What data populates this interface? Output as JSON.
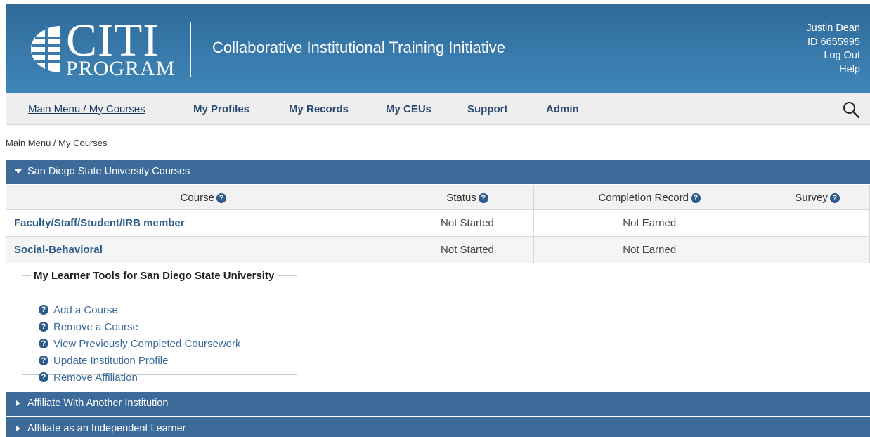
{
  "header": {
    "logo_top": "CITI",
    "logo_bottom": "PROGRAM",
    "tagline": "Collaborative Institutional Training Initiative",
    "user_name": "Justin Dean",
    "user_id": "ID 6655995",
    "logout": "Log Out",
    "help": "Help",
    "brand_color": "#3a7bb0"
  },
  "nav": {
    "items": [
      {
        "label": "Main Menu / My Courses"
      },
      {
        "label": "My Profiles"
      },
      {
        "label": "My Records"
      },
      {
        "label": "My CEUs"
      },
      {
        "label": "Support"
      },
      {
        "label": "Admin"
      }
    ],
    "search_icon": "search-icon"
  },
  "breadcrumb": "Main Menu / My Courses",
  "sections": {
    "sdsu": "San Diego State University Courses",
    "affiliate_other": "Affiliate With Another Institution",
    "affiliate_independent": "Affiliate as an Independent Learner"
  },
  "table": {
    "headers": [
      "Course",
      "Status",
      "Completion Record",
      "Survey"
    ],
    "rows": [
      {
        "course": "Faculty/Staff/Student/IRB member",
        "status": "Not Started",
        "record": "Not Earned",
        "survey": ""
      },
      {
        "course": "Social-Behavioral",
        "status": "Not Started",
        "record": "Not Earned",
        "survey": ""
      }
    ]
  },
  "tools": {
    "legend": "My Learner Tools for San Diego State University",
    "items": [
      {
        "label": "Add a Course"
      },
      {
        "label": "Remove a Course"
      },
      {
        "label": "View Previously Completed Coursework"
      },
      {
        "label": "Update Institution Profile"
      },
      {
        "label": "Remove Affiliation"
      }
    ]
  },
  "help_glyph": "?"
}
